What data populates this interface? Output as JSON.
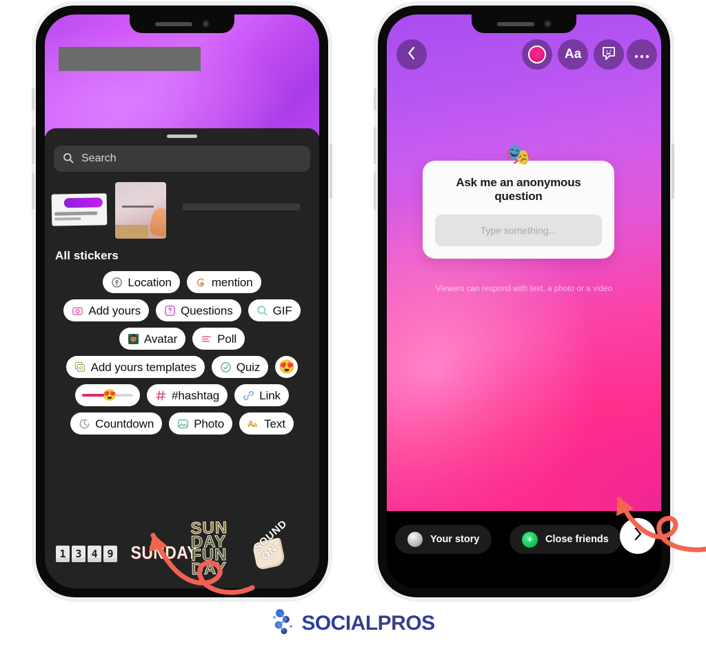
{
  "page": {
    "brand": "SOCIALPROS",
    "brand_icon": "socialpros-node-logo"
  },
  "left_phone": {
    "name": "instagram-story-sticker-tray",
    "story_background_colors": [
      "#b84df0",
      "#d66bff",
      "#a93ce8"
    ],
    "redacted_label": "",
    "search": {
      "placeholder": "Search",
      "icon": "search-icon",
      "value": ""
    },
    "recent_section_label": "",
    "all_stickers_heading": "All stickers",
    "sticker_rows": [
      [
        {
          "label": "Location",
          "icon": "location-pin-icon",
          "color": "#6b6b6b"
        },
        {
          "label": "mention",
          "icon": "threads-mention-icon",
          "color": "#d08a3e"
        }
      ],
      [
        {
          "label": "Add yours",
          "icon": "add-yours-camera-icon",
          "color": "#e060b0"
        },
        {
          "label": "Questions",
          "icon": "question-mark-icon",
          "color": "#c24fd0"
        },
        {
          "label": "GIF",
          "icon": "gif-search-icon",
          "color": "#79c4b4"
        }
      ],
      [
        {
          "label": "Avatar",
          "icon": "avatar-face-icon",
          "color": "#2f6b4f"
        },
        {
          "label": "Poll",
          "icon": "poll-bars-icon",
          "color": "#e0607f"
        }
      ],
      [
        {
          "label": "Add yours templates",
          "icon": "templates-stack-icon",
          "color": "#d9a23c"
        },
        {
          "label": "Quiz",
          "icon": "quiz-check-icon",
          "color": "#5fb89e"
        },
        {
          "label": "",
          "icon": "smiley-emoji-icon",
          "emoji": "😍"
        }
      ],
      [
        {
          "label": "",
          "icon": "emoji-slider-icon",
          "emoji": "😍"
        },
        {
          "label": "#hashtag",
          "icon": "hashtag-icon",
          "color": "#e0557f"
        },
        {
          "label": "Link",
          "icon": "link-chain-icon",
          "color": "#6fa8dc"
        }
      ],
      [
        {
          "label": "Countdown",
          "icon": "countdown-clock-icon",
          "color": "#9b9b9b"
        },
        {
          "label": "Photo",
          "icon": "photo-frame-icon",
          "color": "#63b39c"
        },
        {
          "label": "Text",
          "icon": "text-aa-icon",
          "color": "#d79a2b"
        }
      ]
    ],
    "bottom_stickers": {
      "countdown_digits": [
        "1",
        "3",
        "4",
        "9"
      ],
      "sunday_label": "SUNDAY",
      "sunday_funday_lines": [
        "SUN",
        "DAY",
        "FUN",
        "DAY"
      ],
      "sound_on_label": "SOUND ON"
    }
  },
  "right_phone": {
    "name": "instagram-story-editor",
    "toolbar": {
      "back_icon": "chevron-left-icon",
      "camera_icon": "camera-effects-icon",
      "text_label": "Aa",
      "sticker_icon": "sticker-smiley-icon",
      "more_icon": "more-options-icon"
    },
    "question_sticker": {
      "emoji": "🎭",
      "title": "Ask me an anonymous question",
      "input_placeholder": "Type something...",
      "note": "Viewers can respond with text, a photo or a video"
    },
    "share_bar": {
      "your_story_label": "Your story",
      "your_story_icon": "your-story-avatar",
      "close_friends_label": "Close friends",
      "close_friends_icon": "close-friends-star-icon",
      "next_icon": "chevron-right-icon"
    },
    "story_background_colors": [
      "#a94df0",
      "#e257d8",
      "#ff2e8e"
    ]
  },
  "annotations": {
    "arrow_color": "#f2654f",
    "left_arrow_target": "SUNDAY",
    "right_arrow_target": "next-button"
  }
}
